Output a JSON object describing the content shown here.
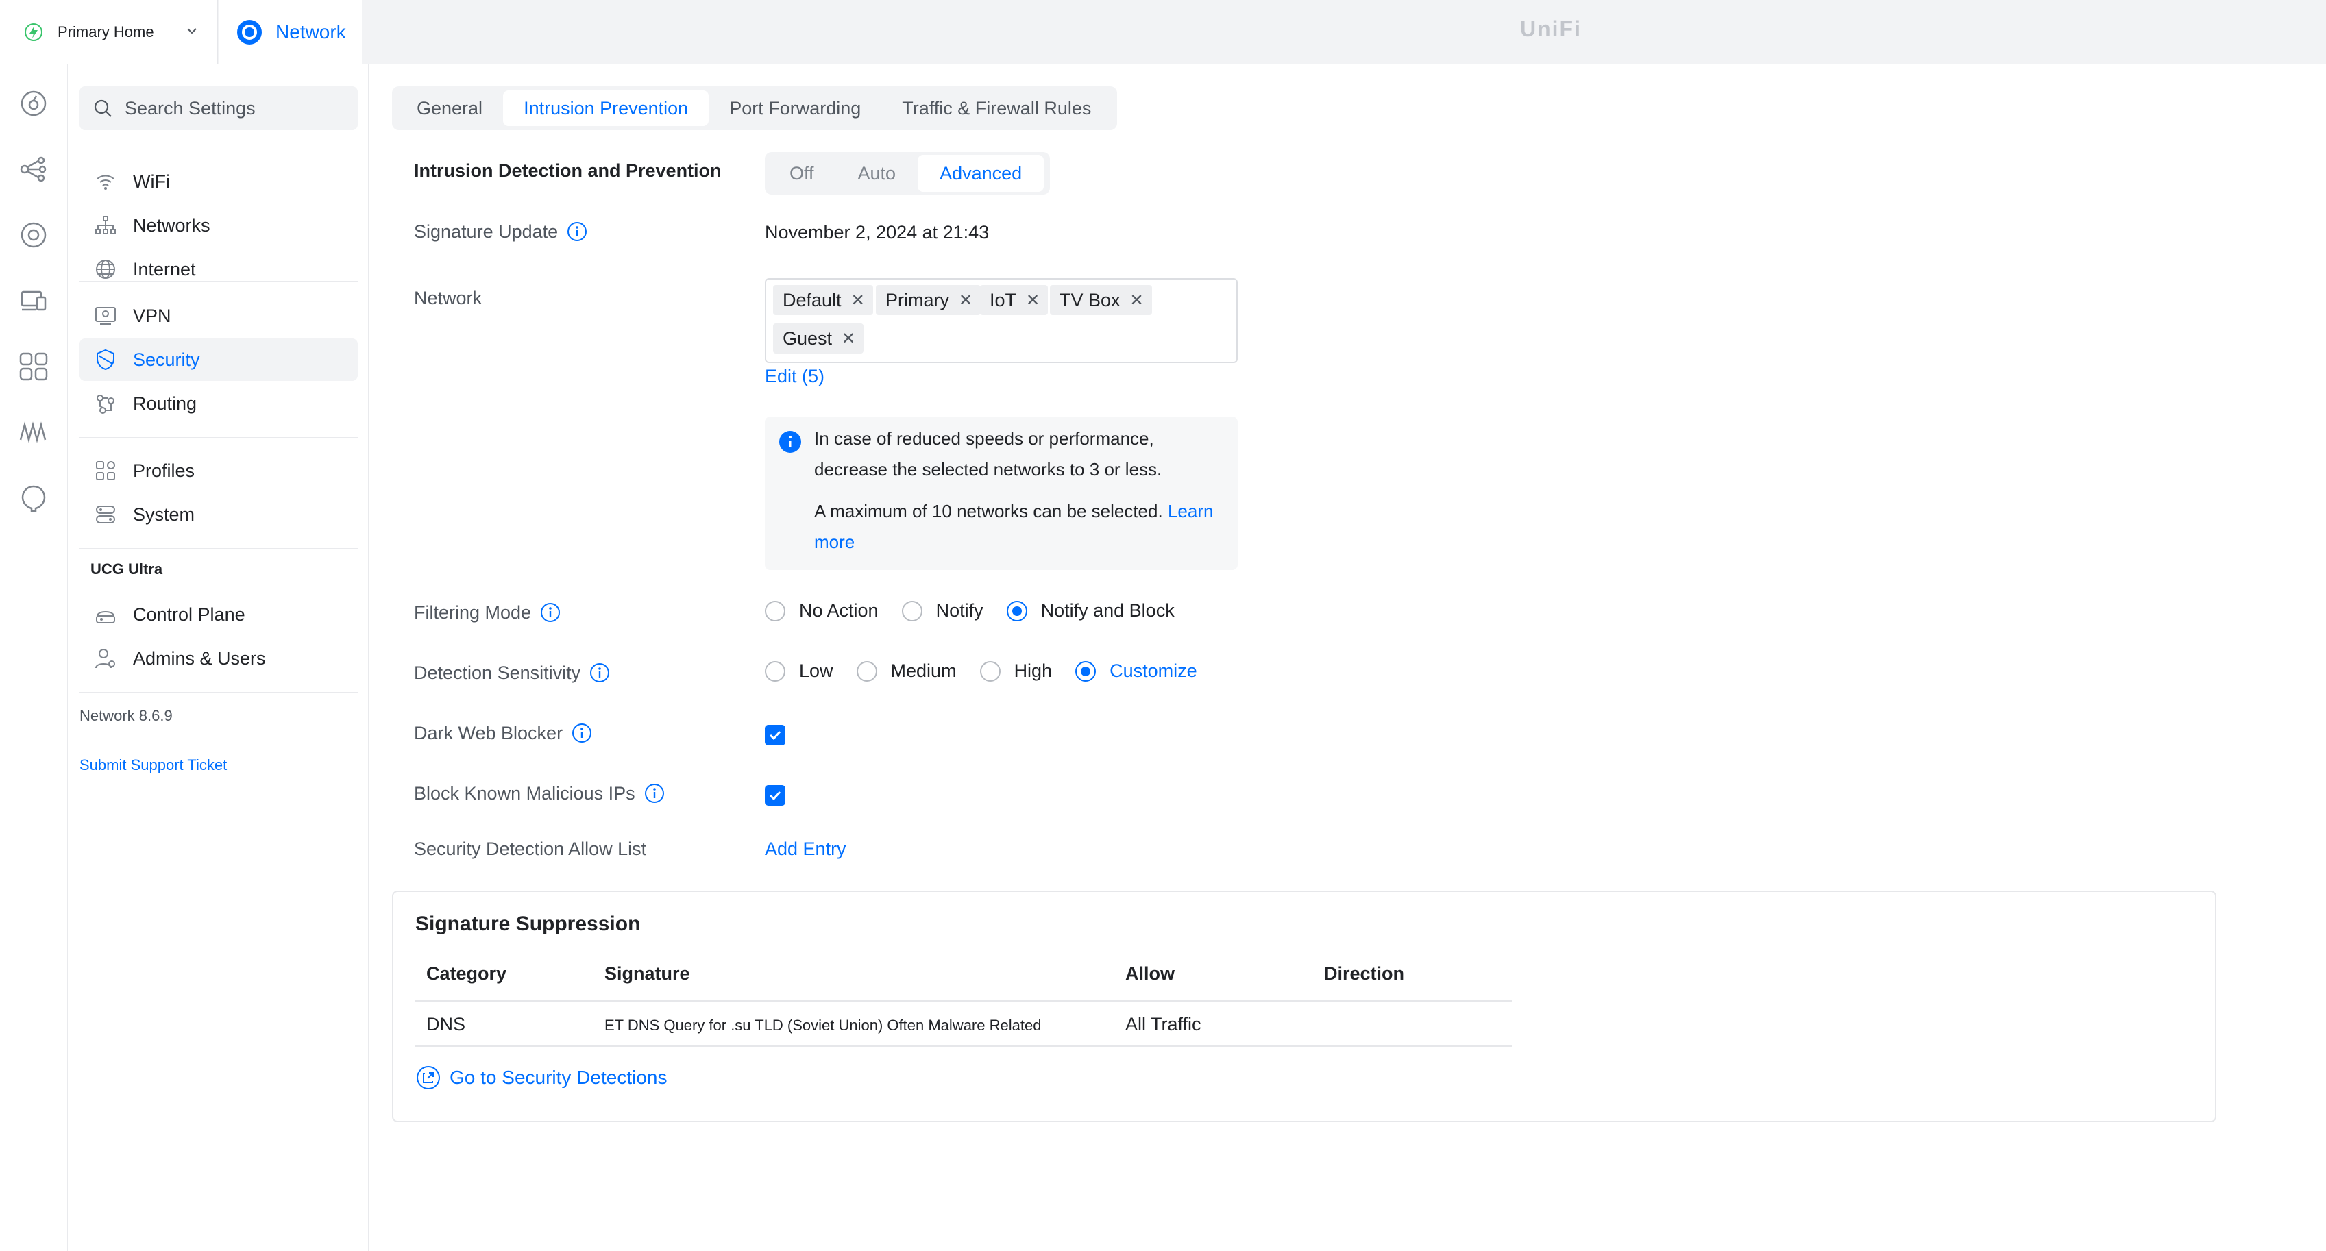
{
  "topbar": {
    "site_name": "Primary Home",
    "app_name": "Network",
    "brand": "UniFi"
  },
  "rail": {
    "icons": [
      "dashboard-icon",
      "topology-icon",
      "devices-icon",
      "clients-icon",
      "insights-icon",
      "radio-waves-icon",
      "alarm-icon"
    ]
  },
  "sidebar": {
    "search_placeholder": "Search Settings",
    "items": [
      {
        "label": "WiFi",
        "icon": "wifi-icon"
      },
      {
        "label": "Networks",
        "icon": "networks-icon"
      },
      {
        "label": "Internet",
        "icon": "globe-icon"
      },
      {
        "label": "VPN",
        "icon": "vpn-icon"
      },
      {
        "label": "Security",
        "icon": "shield-icon",
        "active": true
      },
      {
        "label": "Routing",
        "icon": "routing-icon"
      },
      {
        "label": "Profiles",
        "icon": "profiles-icon"
      },
      {
        "label": "System",
        "icon": "system-icon"
      },
      {
        "label": "Control Plane",
        "icon": "control-plane-icon"
      },
      {
        "label": "Admins & Users",
        "icon": "admins-icon"
      }
    ],
    "section_title": "UCG Ultra",
    "version": "Network 8.6.9",
    "support_link": "Submit Support Ticket"
  },
  "main": {
    "tabs": [
      "General",
      "Intrusion Prevention",
      "Port Forwarding",
      "Traffic & Firewall Rules"
    ],
    "active_tab": "Intrusion Prevention",
    "ids": {
      "label": "Intrusion Detection and Prevention",
      "options": [
        "Off",
        "Auto",
        "Advanced"
      ],
      "selected": "Advanced"
    },
    "signature_update": {
      "label": "Signature Update",
      "value": "November 2, 2024 at 21:43"
    },
    "network": {
      "label": "Network",
      "chips": [
        "Default",
        "Primary",
        "IoT",
        "TV Box",
        "Guest"
      ],
      "edit_link": "Edit (5)"
    },
    "notice": {
      "line1": "In case of reduced speeds or performance, decrease the selected networks to 3 or less.",
      "line2": "A maximum of 10 networks can be selected.",
      "learn_more": "Learn more"
    },
    "filtering_mode": {
      "label": "Filtering Mode",
      "options": [
        "No Action",
        "Notify",
        "Notify and Block"
      ],
      "selected": "Notify and Block"
    },
    "detection_sensitivity": {
      "label": "Detection Sensitivity",
      "options": [
        "Low",
        "Medium",
        "High",
        "Customize"
      ],
      "selected": "Customize"
    },
    "dark_web_blocker": {
      "label": "Dark Web Blocker",
      "checked": true
    },
    "block_malicious": {
      "label": "Block Known Malicious IPs",
      "checked": true
    },
    "allow_list": {
      "label": "Security Detection Allow List",
      "link": "Add Entry"
    },
    "suppression": {
      "title": "Signature Suppression",
      "columns": [
        "Category",
        "Signature",
        "Allow",
        "Direction"
      ],
      "rows": [
        {
          "category": "DNS",
          "signature": "ET DNS Query for .su TLD (Soviet Union) Often Malware Related",
          "allow": "All Traffic",
          "direction": ""
        }
      ],
      "goto_link": "Go to Security Detections"
    }
  },
  "colors": {
    "accent": "#006fff",
    "text": "#212327",
    "muted": "#50565e",
    "panel": "#f2f3f5",
    "site_icon": "#39c46b"
  }
}
